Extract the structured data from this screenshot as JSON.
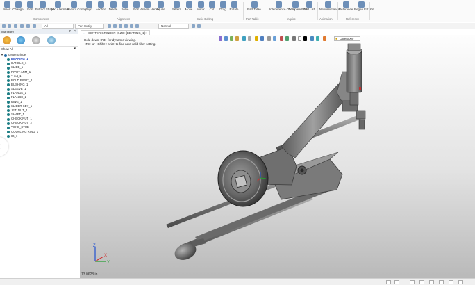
{
  "ribbon": {
    "buttons": [
      {
        "id": "insert",
        "label": "Insert"
      },
      {
        "id": "change",
        "label": "Change"
      },
      {
        "id": "edit",
        "label": "Edit"
      },
      {
        "id": "extract",
        "label": "Extract Shape"
      },
      {
        "id": "add-alt",
        "label": "Add Alternate"
      },
      {
        "id": "record",
        "label": "Record Config"
      },
      {
        "id": "align",
        "label": "Align"
      },
      {
        "id": "anchor",
        "label": "Anchor"
      },
      {
        "id": "delete",
        "label": "Delete"
      },
      {
        "id": "solve",
        "label": "Solve"
      },
      {
        "id": "edit2",
        "label": "Edit"
      },
      {
        "id": "assem-handle",
        "label": "Assem Handle"
      },
      {
        "id": "inquire",
        "label": "Inquire"
      },
      {
        "id": "pattern",
        "label": "Pattern"
      },
      {
        "id": "move",
        "label": "Move"
      },
      {
        "id": "mirror",
        "label": "Mirror"
      },
      {
        "id": "cut",
        "label": "Cut"
      },
      {
        "id": "drag",
        "label": "Drag"
      },
      {
        "id": "rotate",
        "label": "Rotate"
      },
      {
        "id": "part-table",
        "label": "Part Table"
      },
      {
        "id": "interference",
        "label": "Interference Check"
      },
      {
        "id": "compare-parts",
        "label": "Compare Parts"
      },
      {
        "id": "part-list",
        "label": "Part List"
      },
      {
        "id": "new-animation",
        "label": "New Animation"
      },
      {
        "id": "reference",
        "label": "Reference"
      },
      {
        "id": "regen-ext-ref",
        "label": "Regen Ext Ref"
      }
    ],
    "groups": {
      "component": "Component",
      "alignment": "Alignment",
      "basic_editing": "Basic Editing",
      "part_table": "Part Table",
      "inquire": "Inquire",
      "animation": "Animation",
      "reference": "Reference"
    }
  },
  "quickbar": {
    "filter_value": "All",
    "part_entity": "Part Entity",
    "view_mode": "Normal"
  },
  "manager": {
    "title": "Manager",
    "show_all": "Show All",
    "root": "center grinder",
    "items": [
      "BEARING_1",
      "HANDLE_1",
      "SLIDE_1",
      "PIVOT ARM_1",
      "T-nut_1",
      "BOLD PIVOT_1",
      "BUSHING_1",
      "SLEEVE_1",
      "FLANGE_1",
      "FLANGE_2",
      "RING_1",
      "SLIDER KEY_1",
      "JETI NUT_1",
      "SHAFT_1",
      "CHECK NUT_1",
      "CHECK NUT_2",
      "YOKE_STUB",
      "COUPLING RING_1",
      "IG_1"
    ]
  },
  "viewport": {
    "tab_label": "CENTER GRINDER (0.Z3 : [BEARING_1]",
    "hint_line1": "Hold down <F3> for dynamic viewing.",
    "hint_line2": "<F9> or <Shift>+<Alt> to find next valid filter setting.",
    "layer": "Layer0000",
    "distance": "13.0628 in"
  },
  "colors": {
    "accent": "#1f7f86",
    "part_gray": "#7a7a7a",
    "axis_x": "#d03030",
    "axis_y": "#20a030",
    "axis_z": "#2050d0"
  }
}
